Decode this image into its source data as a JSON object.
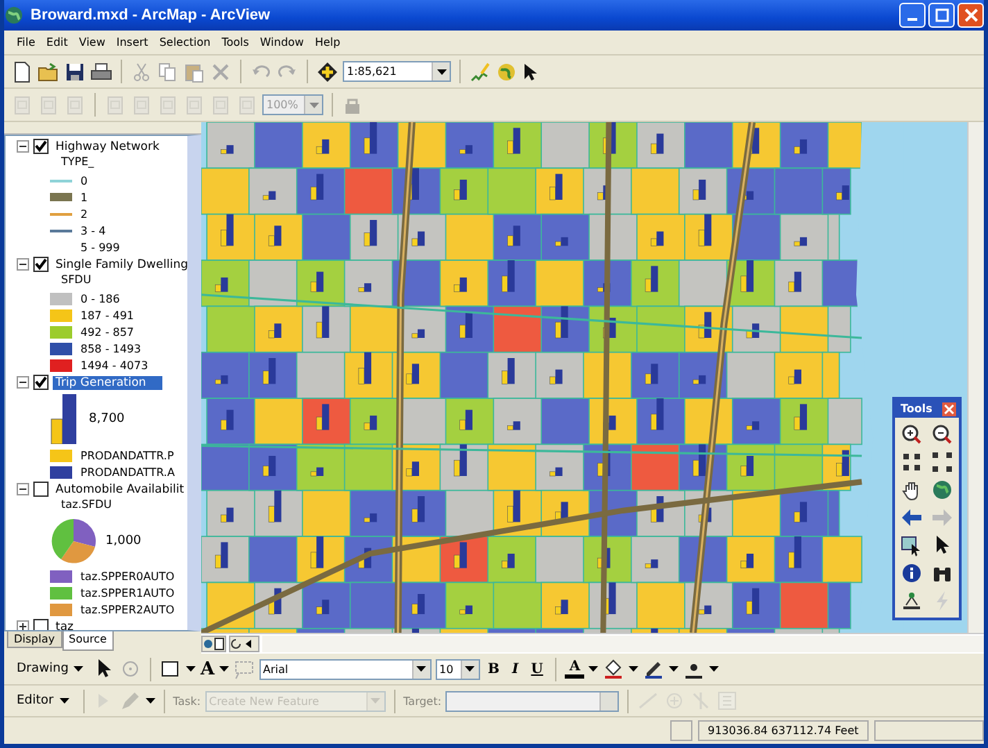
{
  "window": {
    "title": "Broward.mxd - ArcMap - ArcView"
  },
  "menu": [
    "File",
    "Edit",
    "View",
    "Insert",
    "Selection",
    "Tools",
    "Window",
    "Help"
  ],
  "standard_toolbar": {
    "scale": "1:85,621"
  },
  "layout_toolbar": {
    "zoom": "100%",
    "disabled": true
  },
  "toc": {
    "layers": [
      {
        "name": "Highway Network",
        "checked": true,
        "expanded": true,
        "selected": false,
        "field": "TYPE_",
        "legend": [
          {
            "kind": "line",
            "label": "0",
            "color": "#8fd3d8"
          },
          {
            "kind": "thick",
            "label": "1",
            "color": "#7a7550"
          },
          {
            "kind": "line",
            "label": "2",
            "color": "#e0a040"
          },
          {
            "kind": "line",
            "label": "3 - 4",
            "color": "#5a7a9a"
          },
          {
            "kind": "none",
            "label": "5 - 999"
          }
        ]
      },
      {
        "name": "Single Family Dwelling",
        "checked": true,
        "expanded": true,
        "selected": false,
        "field": "SFDU",
        "legend": [
          {
            "kind": "fill",
            "label": "0 - 186",
            "color": "#c0c0c0"
          },
          {
            "kind": "fill",
            "label": "187 - 491",
            "color": "#f5c518"
          },
          {
            "kind": "fill",
            "label": "492 - 857",
            "color": "#9ccc2c"
          },
          {
            "kind": "fill",
            "label": "858 - 1493",
            "color": "#2f4fa8"
          },
          {
            "kind": "fill",
            "label": "1494 - 4073",
            "color": "#e02020"
          }
        ]
      },
      {
        "name": "Trip Generation",
        "checked": true,
        "expanded": true,
        "selected": true,
        "chart": {
          "kind": "bar",
          "label": "8,700"
        },
        "legend": [
          {
            "kind": "fill",
            "label": "PRODANDATTR.P",
            "color": "#f5c518"
          },
          {
            "kind": "fill",
            "label": "PRODANDATTR.A",
            "color": "#2f3f9f"
          }
        ]
      },
      {
        "name": "Automobile Availabilit",
        "checked": false,
        "expanded": true,
        "selected": false,
        "field": "taz.SFDU",
        "chart": {
          "kind": "pie",
          "label": "1,000"
        },
        "legend": [
          {
            "kind": "fill",
            "label": "taz.SPPER0AUTO",
            "color": "#8060c0"
          },
          {
            "kind": "fill",
            "label": "taz.SPPER1AUTO",
            "color": "#60c040"
          },
          {
            "kind": "fill",
            "label": "taz.SPPER2AUTO",
            "color": "#e09840"
          }
        ]
      },
      {
        "name": "taz",
        "checked": false,
        "expanded": false,
        "selected": false
      }
    ]
  },
  "toc_tabs": [
    {
      "label": "Display",
      "selected": false
    },
    {
      "label": "Source",
      "selected": true
    }
  ],
  "tools_window": {
    "title": "Tools"
  },
  "drawing_toolbar": {
    "menu": "Drawing",
    "text_tool": "A",
    "font": "Arial",
    "size": "10",
    "bold": "B",
    "italic": "I",
    "underline": "U",
    "font_color": "A"
  },
  "editor_toolbar": {
    "menu": "Editor",
    "task_label": "Task:",
    "task": "Create New Feature",
    "target_label": "Target:",
    "disabled": true
  },
  "status_bar": {
    "coordinates": "913036.84 637112.74 Feet"
  }
}
